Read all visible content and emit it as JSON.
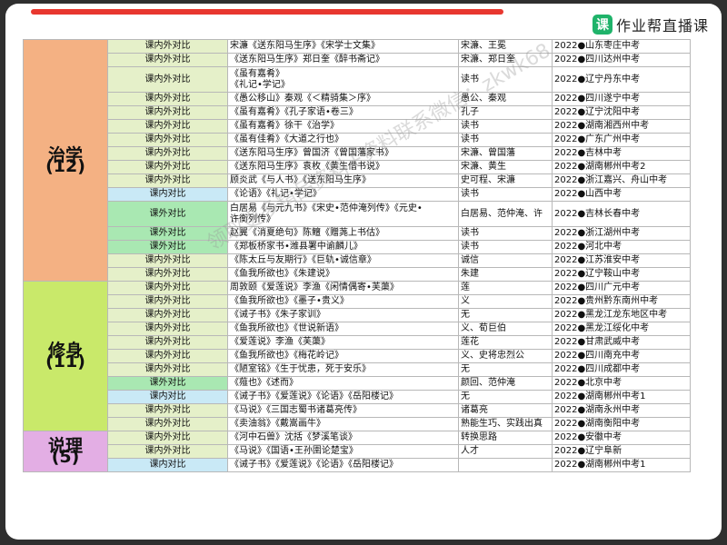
{
  "brand": {
    "logo_glyph": "课",
    "name": "作业帮直播课"
  },
  "watermark": "领取更多精品资料+资料联系微信：zkwk68",
  "colors": {
    "zhixue": "#f4b183",
    "xiushen": "#c9e96a",
    "shuoli": "#e3aee4",
    "type_in_out": "#e5f0c9",
    "type_out": "#a9e8b2",
    "type_in": "#c9e9f6"
  },
  "categories": [
    {
      "label": "治学",
      "count": "(12)",
      "start": 0,
      "span": 16,
      "cls": "cat-zhixue"
    },
    {
      "label": "修身",
      "count": "(11)",
      "start": 16,
      "span": 11,
      "cls": "cat-xiushen"
    },
    {
      "label": "说理",
      "count": "(5)",
      "start": 27,
      "span": 5,
      "cls": "cat-shuoli"
    }
  ],
  "rows": [
    {
      "type": "课内外对比",
      "cls": "typ-a",
      "works": "宋濂《送东阳马生序》《宋学士文集》",
      "authors": "宋濂、王冕",
      "exam": "2022●山东枣庄中考"
    },
    {
      "type": "课内外对比",
      "cls": "typ-a",
      "works": "《送东阳马生序》郑日奎《醉书斋记》",
      "authors": "宋濂、郑日奎",
      "exam": "2022●四川达州中考"
    },
    {
      "type": "课内外对比",
      "cls": "typ-a",
      "works": "《虽有嘉肴》\n《礼记•学记》",
      "authors": "读书",
      "exam": "2022●辽宁丹东中考",
      "tall": true
    },
    {
      "type": "课内外对比",
      "cls": "typ-a",
      "works": "《愚公移山》秦观《＜精骑集＞序》",
      "authors": "愚公、秦观",
      "exam": "2022●四川遂宁中考"
    },
    {
      "type": "课内外对比",
      "cls": "typ-a",
      "works": "《虽有嘉肴》《孔子家语•卷三》",
      "authors": "孔子",
      "exam": "2022●辽宁沈阳中考"
    },
    {
      "type": "课内外对比",
      "cls": "typ-a",
      "works": "《虽有嘉肴》徐干《治学》",
      "authors": "读书",
      "exam": "2022●湖南湘西州中考"
    },
    {
      "type": "课内外对比",
      "cls": "typ-a",
      "works": "《虽有佳肴》《大道之行也》",
      "authors": "读书",
      "exam": "2022●广东广州中考"
    },
    {
      "type": "课内外对比",
      "cls": "typ-a",
      "works": "《送东阳马生序》曾国济《曾国藩家书》",
      "authors": "宋濂、曾国藩",
      "exam": "2022●吉林中考"
    },
    {
      "type": "课内外对比",
      "cls": "typ-a",
      "works": "《送东阳马生序》袁枚《黄生借书说》",
      "authors": "宋濂、黄生",
      "exam": "2022●湖南郴州中考2"
    },
    {
      "type": "课内外对比",
      "cls": "typ-a",
      "works": "顾炎武《与人书》《送东阳马生序》",
      "authors": "史可程、宋濂",
      "exam": "2022●浙江嘉兴、舟山中考"
    },
    {
      "type": "课内对比",
      "cls": "typ-c",
      "works": "《论语》《礼记•学记》",
      "authors": "读书",
      "exam": "2022●山西中考"
    },
    {
      "type": "课外对比",
      "cls": "typ-b",
      "works": "白居易《与元九书》《宋史•范仲淹列传》《元史•\n许衡列传》",
      "authors": "白居易、范仲淹、许",
      "exam": "2022●吉林长春中考",
      "tall": true
    },
    {
      "type": "课外对比",
      "cls": "typ-b",
      "works": "赵翼《消夏绝句》陈鳣《赠荛上书估》",
      "authors": "读书",
      "exam": "2022●浙江湖州中考"
    },
    {
      "type": "课外对比",
      "cls": "typ-b",
      "works": "《郑板桥家书•潍县署中谕麟儿》",
      "authors": "读书",
      "exam": "2022●河北中考"
    },
    {
      "type": "课内外对比",
      "cls": "typ-a",
      "works": "《陈太丘与友期行》《巨轨•诚信章》",
      "authors": "诚信",
      "exam": "2022●江苏淮安中考"
    },
    {
      "type": "课内外对比",
      "cls": "typ-a",
      "works": "《鱼我所欲也》《朱建说》",
      "authors": "朱建",
      "exam": "2022●辽宁鞍山中考"
    },
    {
      "type": "课内外对比",
      "cls": "typ-a",
      "works": "周敦颐《爱莲说》李渔《闲情偶寄•芙蕖》",
      "authors": "莲",
      "exam": "2022●四川广元中考"
    },
    {
      "type": "课内外对比",
      "cls": "typ-a",
      "works": "《鱼我所欲也》《墨子•贵义》",
      "authors": "义",
      "exam": "2022●贵州黔东南州中考"
    },
    {
      "type": "课内外对比",
      "cls": "typ-a",
      "works": "《诫子书》《朱子家训》",
      "authors": "无",
      "exam": "2022●黑龙江龙东地区中考"
    },
    {
      "type": "课内外对比",
      "cls": "typ-a",
      "works": "《鱼我所欲也》《世说新语》",
      "authors": "义、荀巨伯",
      "exam": "2022●黑龙江绥化中考"
    },
    {
      "type": "课内外对比",
      "cls": "typ-a",
      "works": "《爱莲说》李渔《芙蕖》",
      "authors": "莲花",
      "exam": "2022●甘肃武威中考"
    },
    {
      "type": "课内外对比",
      "cls": "typ-a",
      "works": "《鱼我所欲也》《梅花岭记》",
      "authors": "义、史将忠烈公",
      "exam": "2022●四川南充中考"
    },
    {
      "type": "课内外对比",
      "cls": "typ-a",
      "works": "《陋室铭》《生于忧患，死于安乐》",
      "authors": "无",
      "exam": "2022●四川成都中考"
    },
    {
      "type": "课外对比",
      "cls": "typ-b",
      "works": "《薤也》《述而》",
      "authors": "颜回、范仲淹",
      "exam": "2022●北京中考"
    },
    {
      "type": "课内对比",
      "cls": "typ-c",
      "works": "《诫子书》《爱莲说》《论语》《岳阳楼记》",
      "authors": "无",
      "exam": "2022●湖南郴州中考1"
    },
    {
      "type": "课内外对比",
      "cls": "typ-a",
      "works": "《马说》《三国志蜀书诸葛亮传》",
      "authors": "诸葛亮",
      "exam": "2022●湖南永州中考"
    },
    {
      "type": "课内外对比",
      "cls": "typ-a",
      "works": "《卖油翁》《戴嵩画牛》",
      "authors": "熟能生巧、实践出真",
      "exam": "2022●湖南衡阳中考"
    },
    {
      "type": "课内外对比",
      "cls": "typ-a",
      "works": "《河中石兽》沈括《梦溪笔谈》",
      "authors": "转换思路",
      "exam": "2022●安徽中考"
    },
    {
      "type": "课内外对比",
      "cls": "typ-a",
      "works": "《马说》《国语•王孙圉论楚宝》",
      "authors": "人才",
      "exam": "2022●辽宁阜新"
    },
    {
      "type": "课内对比",
      "cls": "typ-c",
      "works": "《诫子书》《爱莲说》《论语》《岳阳楼记》",
      "authors": "",
      "exam": "2022●湖南郴州中考1"
    }
  ]
}
